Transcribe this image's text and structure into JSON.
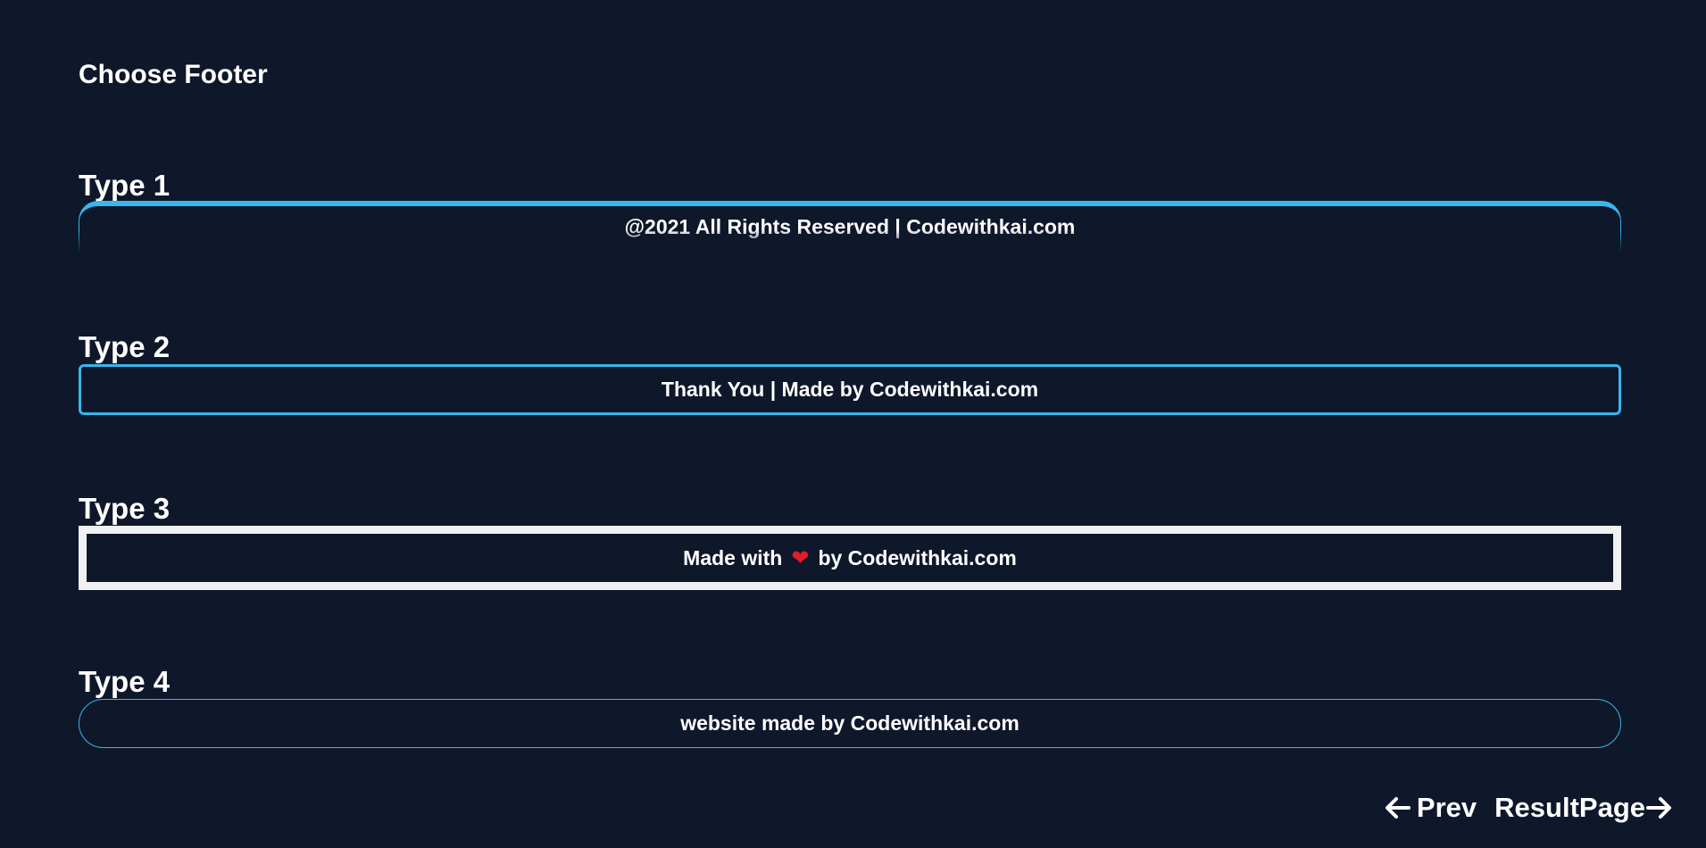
{
  "page": {
    "title": "Choose Footer"
  },
  "footers": [
    {
      "label": "Type 1",
      "text": "@2021 All Rights Reserved | Codewithkai.com"
    },
    {
      "label": "Type 2",
      "text": "Thank You | Made by Codewithkai.com"
    },
    {
      "label": "Type 3",
      "text_before": "Made with",
      "icon": "heart-icon",
      "text_after": "by Codewithkai.com"
    },
    {
      "label": "Type 4",
      "text": "website made by Codewithkai.com"
    }
  ],
  "nav": {
    "prev_label": "Prev",
    "prev_icon": "arrow-left-icon",
    "next_label": "ResultPage",
    "next_icon": "arrow-right-icon"
  },
  "colors": {
    "background": "#0f172a",
    "accent": "#38b6ee",
    "type3_border": "#f1f1f3",
    "heart": "#e11d2a",
    "text": "#ffffff"
  }
}
